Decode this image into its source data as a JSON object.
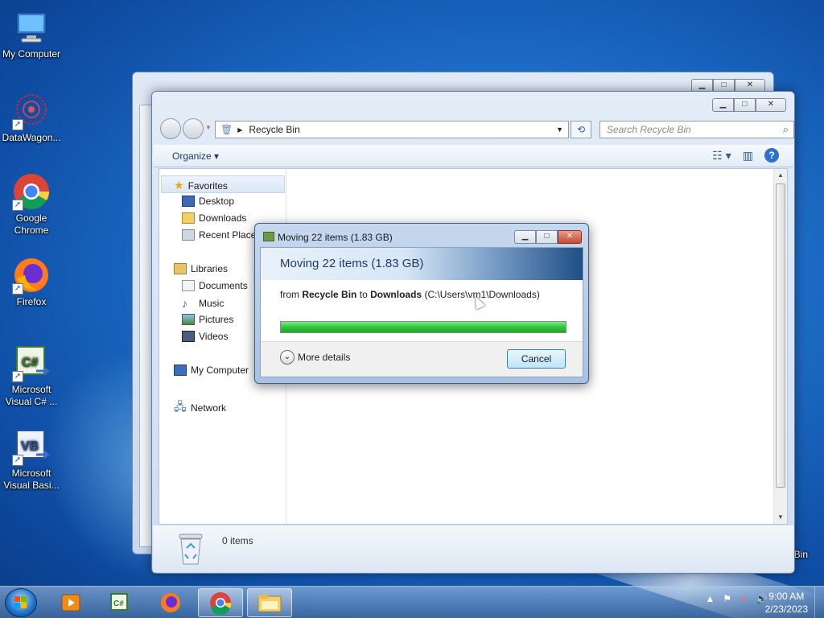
{
  "desktop": {
    "icons": [
      {
        "label": "My Computer"
      },
      {
        "label": "DataWagon..."
      },
      {
        "label": "Google Chrome"
      },
      {
        "label": "Firefox"
      },
      {
        "label": "Microsoft Visual C# ..."
      },
      {
        "label": "Microsoft Visual Basi..."
      },
      {
        "label": "Bin"
      }
    ]
  },
  "explorer": {
    "breadcrumb": "Recycle Bin",
    "search_placeholder": "Search Recycle Bin",
    "organize_label": "Organize ▾",
    "nav": {
      "favorites": "Favorites",
      "desktop": "Desktop",
      "downloads": "Downloads",
      "recent": "Recent Places",
      "libraries": "Libraries",
      "documents": "Documents",
      "music": "Music",
      "pictures": "Pictures",
      "videos": "Videos",
      "computer": "My Computer",
      "network": "Network"
    },
    "items_count": "0 items"
  },
  "dialog": {
    "title": "Moving 22 items (1.83 GB)",
    "heading": "Moving 22 items (1.83 GB)",
    "from_prefix": "from",
    "source": "Recycle Bin",
    "to_word": "to",
    "dest": "Downloads",
    "dest_path": "(C:\\Users\\vm1\\Downloads)",
    "progress_percent": 100,
    "more_details": "More details",
    "cancel": "Cancel"
  },
  "taskbar": {
    "time": "9:00 AM",
    "date": "2/23/2023"
  },
  "colors": {
    "progress_green": "#2fc73b",
    "accent_blue": "#1e6fc8"
  }
}
